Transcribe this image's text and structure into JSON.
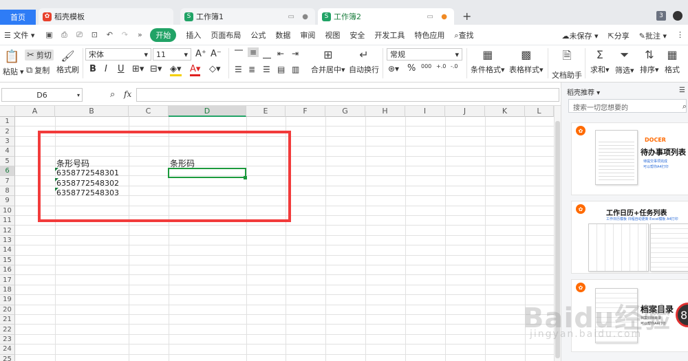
{
  "tabs": {
    "home": "首页",
    "tab1": "稻壳模板",
    "tab2": "工作簿1",
    "tab3": "工作簿2",
    "count": "3"
  },
  "menu": {
    "file": "文件",
    "items": [
      "开始",
      "插入",
      "页面布局",
      "公式",
      "数据",
      "审阅",
      "视图",
      "安全",
      "开发工具",
      "特色应用"
    ],
    "search": "查找",
    "unsaved": "未保存",
    "share": "分享",
    "comment": "批注"
  },
  "ribbon": {
    "paste": "粘贴",
    "cut": "剪切",
    "copy": "复制",
    "format_painter": "格式刷",
    "font_name": "宋体",
    "font_size": "11",
    "bold": "B",
    "italic": "I",
    "underline": "U",
    "merge_center": "合并居中",
    "wrap_text": "自动换行",
    "number_format": "常规",
    "percent": "%",
    "thousands": "000",
    "inc_decimal": "+.0",
    "dec_decimal": "-.0",
    "cond_format": "条件格式",
    "table_style": "表格样式",
    "doc_assistant": "文档助手",
    "sum": "求和",
    "filter": "筛选",
    "sort": "排序",
    "format": "格式"
  },
  "formula_bar": {
    "name_box": "D6",
    "fx": "fx",
    "content": ""
  },
  "grid": {
    "columns": [
      "A",
      "B",
      "C",
      "D",
      "E",
      "F",
      "G",
      "H",
      "I",
      "J",
      "K",
      "L"
    ],
    "active_column": "D",
    "rows": [
      "1",
      "2",
      "3",
      "4",
      "5",
      "6",
      "7",
      "8",
      "9",
      "10",
      "11",
      "12",
      "13",
      "14",
      "15",
      "16",
      "17",
      "18",
      "19",
      "20",
      "21",
      "22",
      "23",
      "24",
      "25"
    ],
    "active_row": "6",
    "cells": {
      "B5": "条形号码",
      "D5": "条形码",
      "B6": "6358772548301",
      "B7": "6358772548302",
      "B8": "6358772548303"
    }
  },
  "right_panel": {
    "title": "稻壳推荐",
    "search_placeholder": "搜索一切您想要的",
    "cards": [
      {
        "title": "待办事项列表",
        "sub1": "待提交事项完成",
        "sub2": "可以帮你A4打印",
        "logo": "DOCER"
      },
      {
        "title": "工作日历+任务列表",
        "sub1": "工作日历模板 日程自动更新 Excel模板 A4打印"
      },
      {
        "title": "档案目录",
        "sub1": "档案归档目录",
        "sub2": "可以帮你A4打印"
      }
    ]
  },
  "watermark": {
    "main": "Baidu经验",
    "sub": "jingyan.baidu.com"
  },
  "floating_badge": "8"
}
